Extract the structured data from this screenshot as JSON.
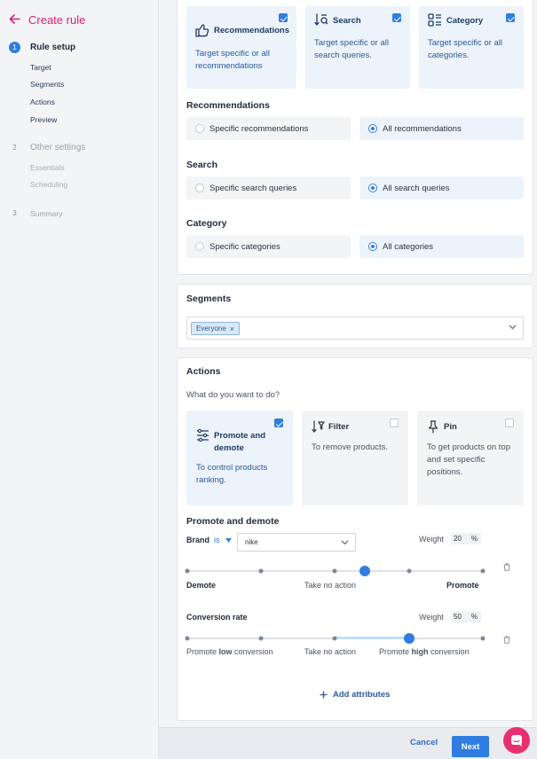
{
  "sidebar": {
    "title": "Create rule",
    "steps": [
      {
        "num": "1",
        "label": "Rule setup",
        "substeps": [
          "Target",
          "Segments",
          "Actions",
          "Preview"
        ]
      },
      {
        "num": "2",
        "label": "Other settings",
        "substeps": [
          "Essentials",
          "Scheduling"
        ]
      },
      {
        "num": "3",
        "label": "Summary"
      }
    ]
  },
  "target": {
    "cards": [
      {
        "title": "Recommendations",
        "desc": "Target specific or all recommendations",
        "checked": true,
        "icon": "thumbs-up-icon"
      },
      {
        "title": "Search",
        "desc": "Target specific or all search queries.",
        "checked": true,
        "icon": "sort-search-icon"
      },
      {
        "title": "Category",
        "desc": "Target specific or all categories.",
        "checked": true,
        "icon": "category-grid-icon"
      }
    ],
    "groups": [
      {
        "label": "Recommendations",
        "options": [
          "Specific recommendations",
          "All recommendations"
        ],
        "selected": 1
      },
      {
        "label": "Search",
        "options": [
          "Specific search queries",
          "All search queries"
        ],
        "selected": 1
      },
      {
        "label": "Category",
        "options": [
          "Specific categories",
          "All categories"
        ],
        "selected": 1
      }
    ]
  },
  "segments": {
    "title": "Segments",
    "chip": "Everyone"
  },
  "actions": {
    "title": "Actions",
    "question": "What do you want to do?",
    "cards": [
      {
        "title": "Promote and demote",
        "desc": "To control products ranking.",
        "checked": true,
        "icon": "sliders-icon"
      },
      {
        "title": "Filter",
        "desc": "To remove products.",
        "checked": false,
        "icon": "filter-sort-icon"
      },
      {
        "title": "Pin",
        "desc": "To get products on top and set specific positions.",
        "checked": false,
        "icon": "pin-icon"
      }
    ],
    "promote_demote": {
      "title": "Promote and demote",
      "brand": {
        "label": "Brand",
        "operator": "is",
        "value": "nike",
        "weight_label": "Weight",
        "weight": "20",
        "unit": "%",
        "scale": [
          "Demote",
          "Take no action",
          "Promote"
        ],
        "level": 0.6
      },
      "conversion": {
        "label": "Conversion rate",
        "weight_label": "Weight",
        "weight": "50",
        "unit": "%",
        "scale_left_pre": "Promote",
        "scale_left_bold": "low",
        "scale_left_post": "conversion",
        "scale_mid": "Take no action",
        "scale_right_pre": "Promote",
        "scale_right_bold": "high",
        "scale_right_post": "conversion",
        "level": 0.75
      },
      "add_label": "Add attributes"
    }
  },
  "footer": {
    "cancel": "Cancel",
    "next": "Next"
  },
  "colors": {
    "accent": "#2f7de1",
    "brand": "#d6237a",
    "chat": "#e8306f"
  }
}
